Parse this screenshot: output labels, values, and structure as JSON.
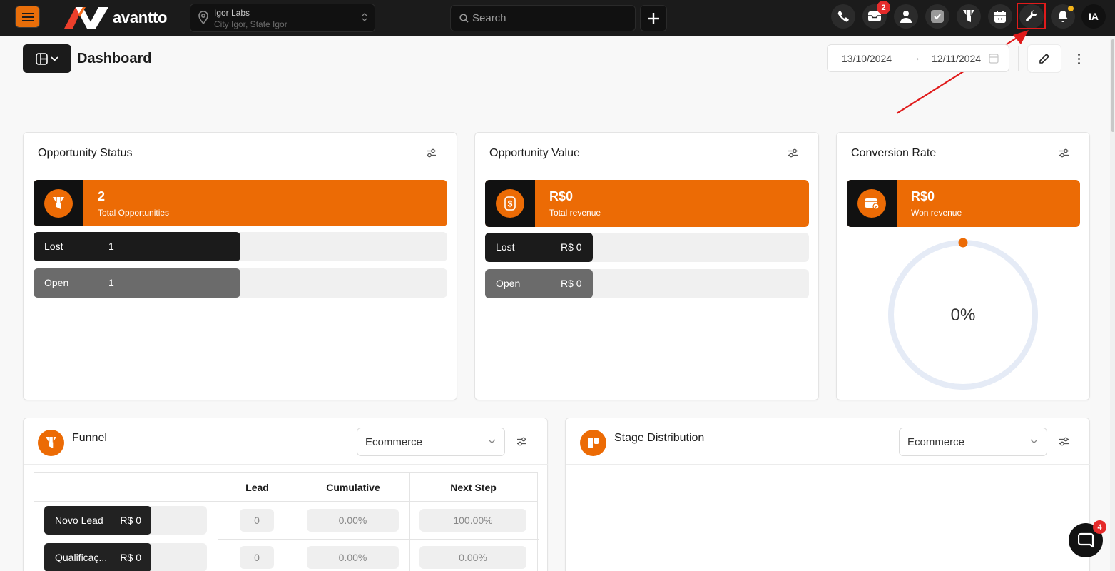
{
  "topbar": {
    "brand": "avantto",
    "location": {
      "name": "Igor Labs",
      "subtitle": "City Igor, State Igor"
    },
    "search": {
      "placeholder": "Search"
    },
    "inbox_badge": "2",
    "avatar_initials": "IA",
    "icons": [
      "menu-icon",
      "pin-icon",
      "search-icon",
      "plus-icon",
      "phone-icon",
      "inbox-icon",
      "user-icon",
      "tasks-icon",
      "funnel-icon",
      "calendar-icon",
      "wrench-icon",
      "bell-icon"
    ],
    "colors": {
      "bar": "#1b1b1b",
      "accent": "#ec6b05",
      "badge": "#e52b2b",
      "highlight": "#e01b1b"
    }
  },
  "header": {
    "title": "Dashboard",
    "date_start": "13/10/2024",
    "date_arrow": "→",
    "date_end": "12/11/2024"
  },
  "opportunity_status": {
    "title": "Opportunity Status",
    "stat": {
      "value": "2",
      "label": "Total Opportunities"
    },
    "rows": [
      {
        "label": "Lost",
        "value": "1",
        "share": 0.5,
        "color": "#1b1b1b"
      },
      {
        "label": "Open",
        "value": "1",
        "share": 0.5,
        "color": "#6b6b6b"
      }
    ]
  },
  "opportunity_value": {
    "title": "Opportunity Value",
    "stat": {
      "value": "R$0",
      "label": "Total revenue"
    },
    "rows": [
      {
        "label": "Lost",
        "value": "R$ 0",
        "color": "#1b1b1b"
      },
      {
        "label": "Open",
        "value": "R$ 0",
        "color": "#6b6b6b"
      }
    ]
  },
  "conversion_rate": {
    "title": "Conversion Rate",
    "stat": {
      "value": "R$0",
      "label": "Won revenue"
    },
    "gauge": {
      "percent_label": "0%",
      "percent": 0
    }
  },
  "funnel": {
    "title": "Funnel",
    "select": "Ecommerce",
    "columns": [
      "Lead",
      "Cumulative",
      "Next Step"
    ],
    "rows": [
      {
        "stage": "Novo Lead",
        "value": "R$ 0",
        "lead": "0",
        "cumulative": "0.00%",
        "next_step": "100.00%"
      },
      {
        "stage": "Qualificaç...",
        "value": "R$ 0",
        "lead": "0",
        "cumulative": "0.00%",
        "next_step": "0.00%"
      }
    ]
  },
  "stage_distribution": {
    "title": "Stage Distribution",
    "select": "Ecommerce"
  },
  "chat": {
    "badge": "4"
  }
}
